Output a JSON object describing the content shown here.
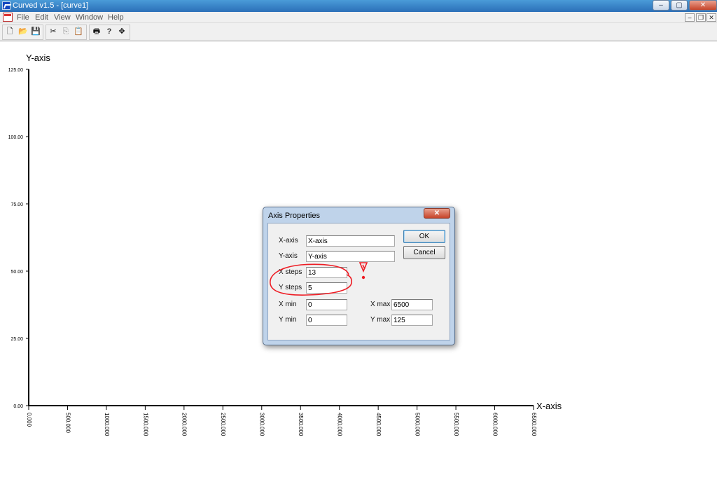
{
  "window": {
    "title": "Curved v1.5 - [curve1]",
    "minimize_glyph": "–",
    "maximize_glyph": "▢",
    "close_glyph": "✕"
  },
  "menu": {
    "items": [
      "File",
      "Edit",
      "View",
      "Window",
      "Help"
    ],
    "mdi_minimize": "–",
    "mdi_restore": "❐",
    "mdi_close": "✕"
  },
  "toolbar": {
    "icons": [
      "new-icon",
      "open-icon",
      "save-icon",
      "cut-icon",
      "copy-icon",
      "paste-icon",
      "print-icon",
      "help-icon",
      "move-icon"
    ],
    "glyphs": {
      "new": "🗋",
      "open": "📂",
      "save": "💾",
      "cut": "✂",
      "copy": "⎘",
      "paste": "📋",
      "print": "🖶",
      "help": "?",
      "move": "✥"
    }
  },
  "chart_data": {
    "type": "line",
    "xlabel": "X-axis",
    "ylabel": "Y-axis",
    "xlim": [
      0,
      6500
    ],
    "ylim": [
      0,
      125
    ],
    "x_ticks": [
      "0.000",
      "500.000",
      "1000.000",
      "1500.000",
      "2000.000",
      "2500.000",
      "3000.000",
      "3500.000",
      "4000.000",
      "4500.000",
      "5000.000",
      "5500.000",
      "6000.000",
      "6500.000"
    ],
    "y_ticks": [
      "0.00",
      "25.00",
      "50.00",
      "75.00",
      "100.00",
      "125.00"
    ],
    "series": []
  },
  "dialog": {
    "title": "Axis Properties",
    "close_glyph": "✕",
    "fields": {
      "x_axis": {
        "label": "X-axis",
        "value": "X-axis"
      },
      "y_axis": {
        "label": "Y-axis",
        "value": "Y-axis"
      },
      "x_steps": {
        "label": "X steps",
        "value": "13"
      },
      "y_steps": {
        "label": "Y steps",
        "value": "5"
      },
      "x_min": {
        "label": "X min",
        "value": "0"
      },
      "x_max": {
        "label": "X max",
        "value": "6500"
      },
      "y_min": {
        "label": "Y min",
        "value": "0"
      },
      "y_max": {
        "label": "Y max",
        "value": "125"
      }
    },
    "ok_label": "OK",
    "cancel_label": "Cancel"
  },
  "annotation": {
    "color": "#ee1c24"
  }
}
